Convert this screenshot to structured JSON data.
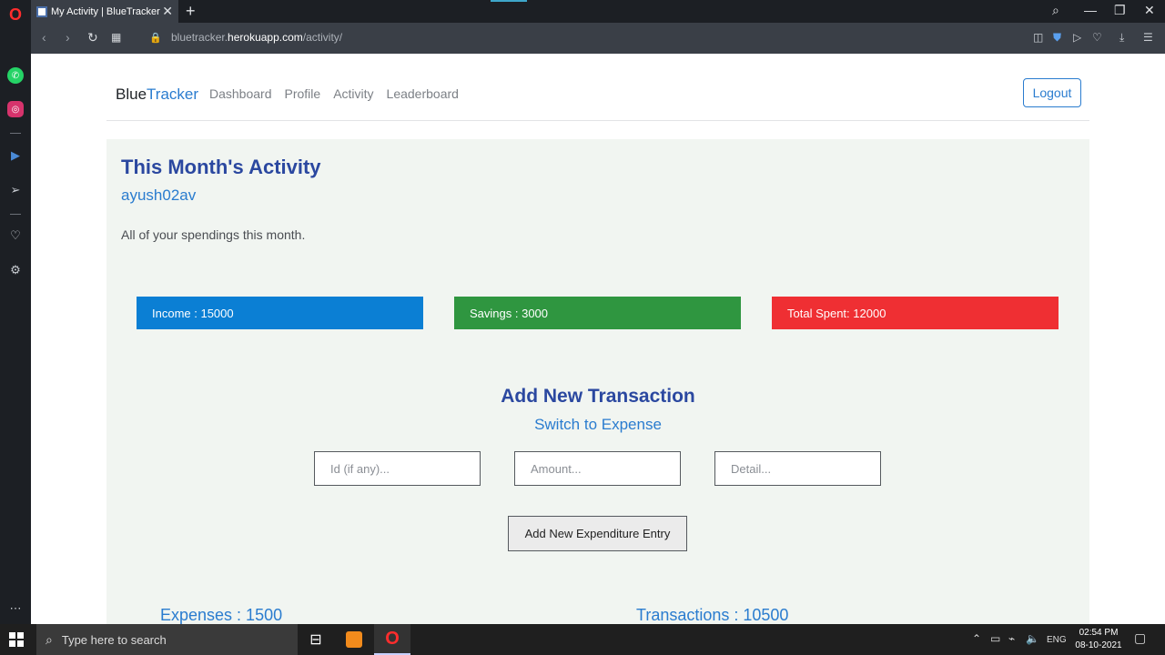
{
  "browser": {
    "tab_title": "My Activity | BlueTracker",
    "new_tab_label": "+",
    "url_prefix": "bluetracker.",
    "url_host": "herokuapp.com",
    "url_path": "/activity/"
  },
  "navbar": {
    "brand_main": "Blue",
    "brand_accent": "Tracker",
    "links": [
      "Dashboard",
      "Profile",
      "Activity",
      "Leaderboard"
    ],
    "logout_label": "Logout"
  },
  "page": {
    "title": "This Month's Activity",
    "username": "ayush02av",
    "description": "All of your spendings this month.",
    "cards": {
      "income": "Income : 15000",
      "savings": "Savings : 3000",
      "spent": "Total Spent: 12000"
    },
    "add_title": "Add New Transaction",
    "switch_label": "Switch to Expense",
    "inputs": {
      "id_placeholder": "Id (if any)...",
      "amount_placeholder": "Amount...",
      "detail_placeholder": "Detail..."
    },
    "add_button": "Add New Expenditure Entry",
    "expenses": "Expenses : 1500",
    "transactions": "Transactions : 10500"
  },
  "taskbar": {
    "search_placeholder": "Type here to search",
    "language": "ENG",
    "time": "02:54 PM",
    "date": "08-10-2021"
  },
  "colors": {
    "brand_blue": "#2a7ccf",
    "heading": "#2b48a0",
    "income": "#0b7fd4",
    "savings": "#2f9640",
    "spent": "#ef2f33"
  }
}
